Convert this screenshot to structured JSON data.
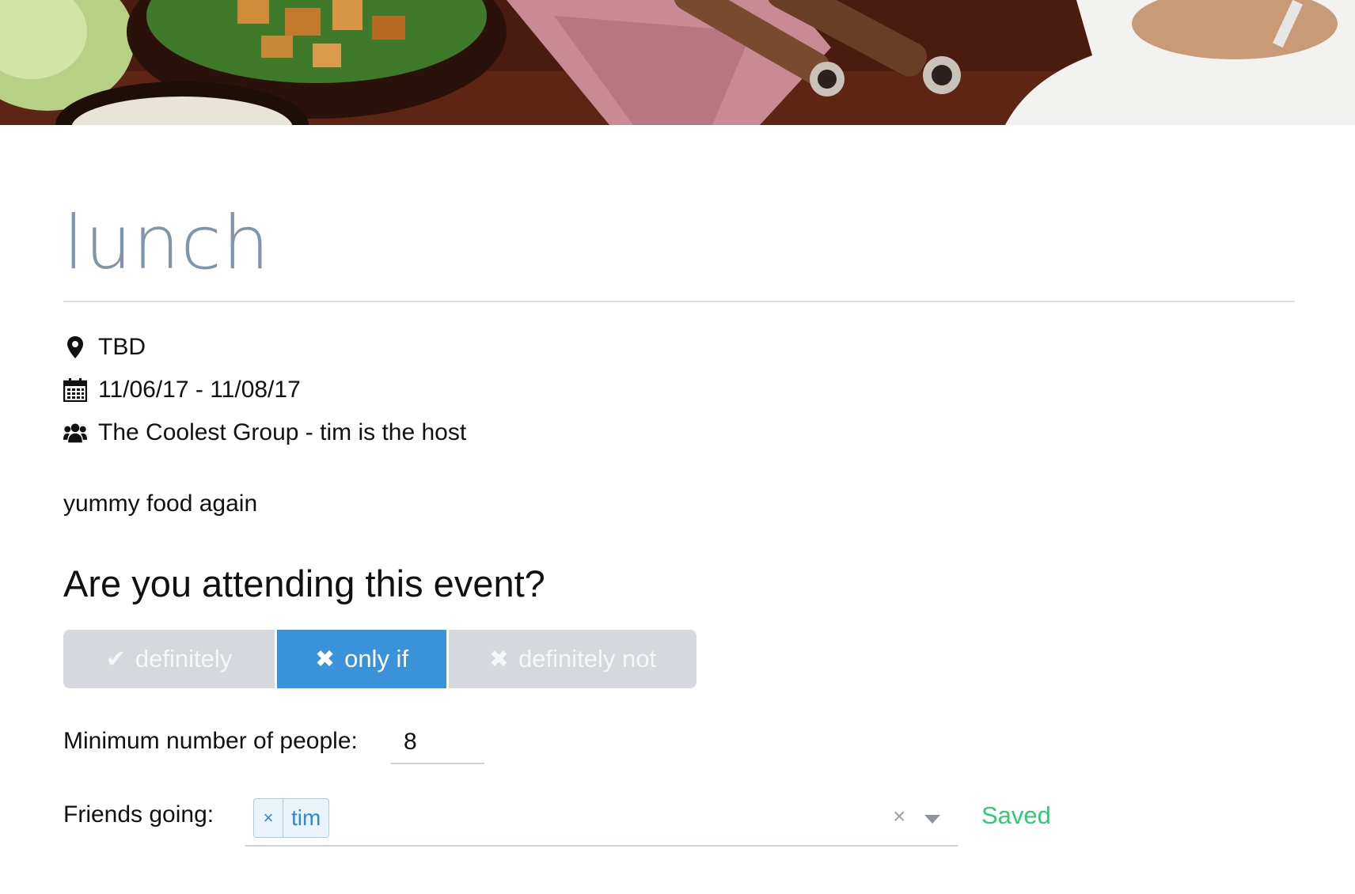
{
  "event": {
    "title": "lunch",
    "location": "TBD",
    "dates": "11/06/17 - 11/08/17",
    "group": "The Coolest Group - tim is the host",
    "description": "yummy food again"
  },
  "rsvp": {
    "question": "Are you attending this event?",
    "options": [
      {
        "label": "definitely",
        "glyph": "✔",
        "active": false
      },
      {
        "label": "only if",
        "glyph": "✖",
        "active": true
      },
      {
        "label": "definitely not",
        "glyph": "✖",
        "active": false
      }
    ]
  },
  "min_people": {
    "label": "Minimum number of people:",
    "value": "8"
  },
  "friends": {
    "label": "Friends going:",
    "tags": [
      "tim"
    ],
    "tag_remove": "×",
    "clear": "×",
    "status": "Saved"
  },
  "icons": {
    "location": "map-marker-icon",
    "dates": "calendar-icon",
    "group": "users-icon"
  },
  "colors": {
    "accent": "#3a93d8",
    "title": "#8096a8",
    "saved": "#2ecc71",
    "inactive_button": "#d5d9dd"
  }
}
